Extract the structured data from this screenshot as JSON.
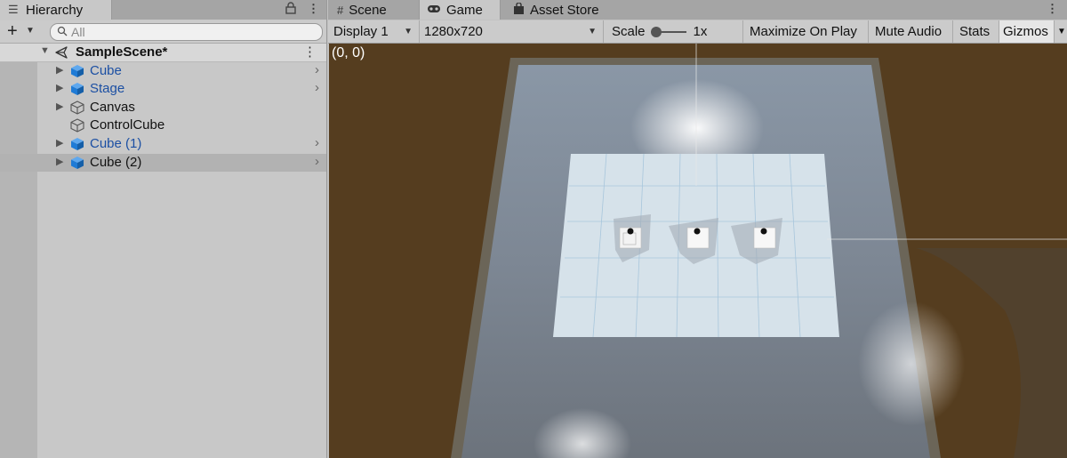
{
  "hierarchy": {
    "tab_label": "Hierarchy",
    "tab_icon": "list-icon",
    "search_placeholder": "All",
    "scene_name": "SampleScene*",
    "items": [
      {
        "label": "Cube",
        "type": "prefab"
      },
      {
        "label": "Stage",
        "type": "prefab"
      },
      {
        "label": "Canvas",
        "type": "object"
      },
      {
        "label": "ControlCube",
        "type": "object"
      },
      {
        "label": "Cube (1)",
        "type": "prefab"
      },
      {
        "label": "Cube (2)",
        "type": "object",
        "selected": true
      }
    ]
  },
  "tabs": {
    "scene": "Scene",
    "game": "Game",
    "asset_store": "Asset Store"
  },
  "game_toolbar": {
    "display": "Display 1",
    "resolution": "1280x720",
    "scale_label": "Scale",
    "scale_value": "1x",
    "maximize": "Maximize On Play",
    "mute": "Mute Audio",
    "stats": "Stats",
    "gizmos": "Gizmos"
  },
  "viewport": {
    "coord_readout": "(0, 0)"
  },
  "colors": {
    "prefab_text": "#1b4fa3",
    "prefab_icon": "#1f7bd6",
    "viewport_bg": "#553d1f",
    "panel_bg": "#c8c8c8"
  }
}
